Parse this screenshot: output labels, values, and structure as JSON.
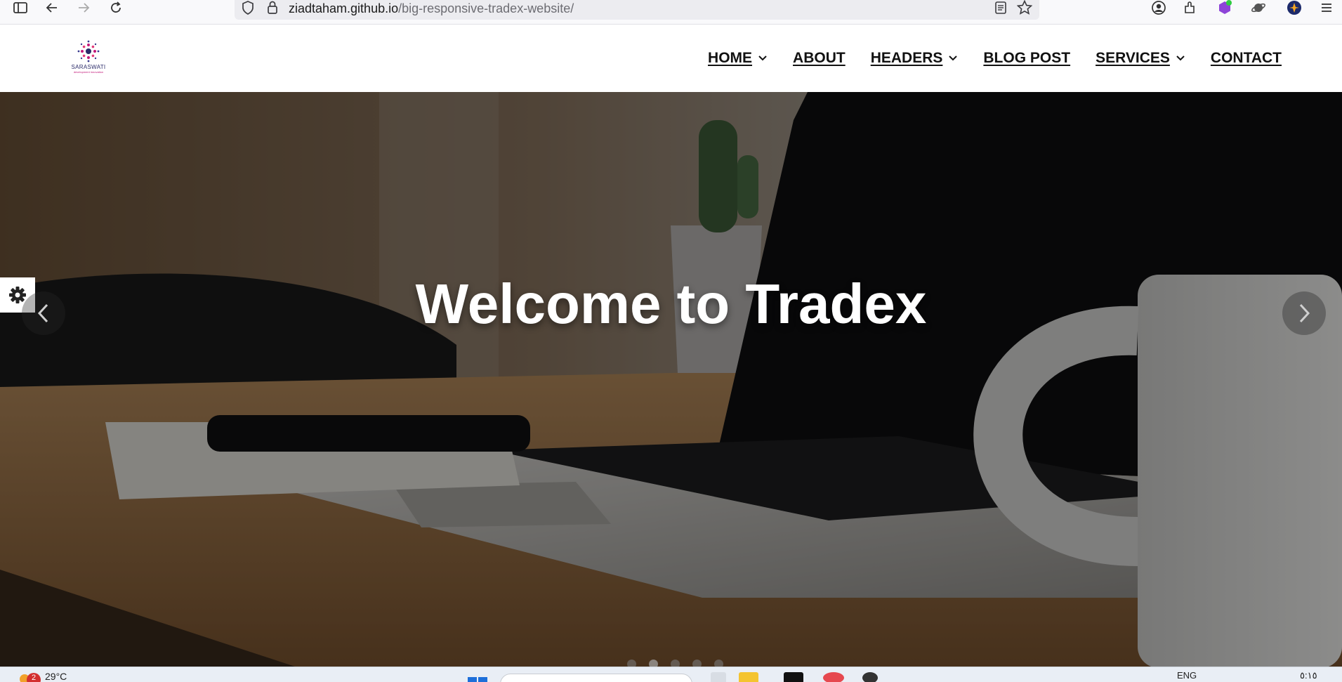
{
  "browser": {
    "url_host": "ziadtaham.github.io",
    "url_path": "/big-responsive-tradex-website/"
  },
  "site": {
    "logo_text": "SARASWATI",
    "logo_sub": "development innovation",
    "nav": [
      {
        "label": "HOME",
        "has_dropdown": true
      },
      {
        "label": "ABOUT",
        "has_dropdown": false
      },
      {
        "label": "HEADERS",
        "has_dropdown": true
      },
      {
        "label": "BLOG POST",
        "has_dropdown": false
      },
      {
        "label": "SERVICES",
        "has_dropdown": true
      },
      {
        "label": "CONTACT",
        "has_dropdown": false
      }
    ]
  },
  "hero": {
    "title": "Welcome to Tradex",
    "slide_count": 5
  },
  "taskbar": {
    "weather_badge": "2",
    "temperature": "29°C",
    "language": "ENG",
    "clock": "٥:١٥"
  },
  "colors": {
    "nav_text": "#111111",
    "hero_overlay": "#000000",
    "accent_logo": "#c2187a"
  }
}
